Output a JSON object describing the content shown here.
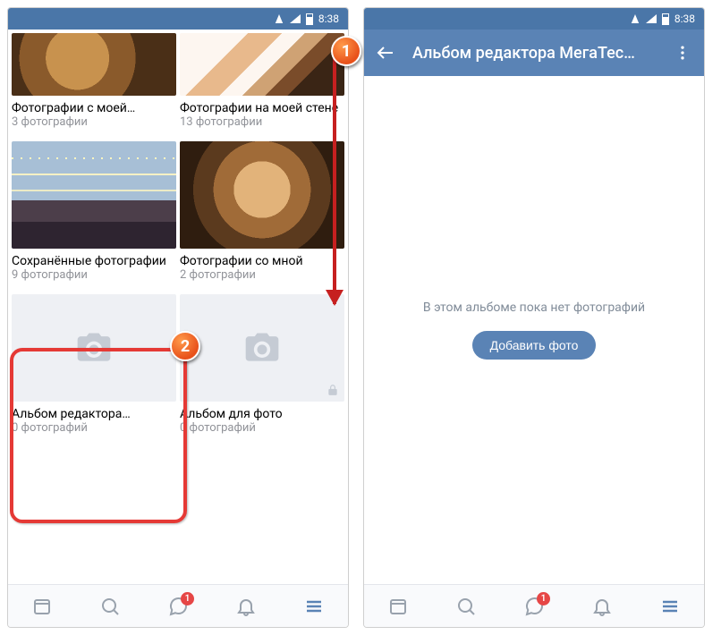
{
  "statusbar": {
    "time": "8:38"
  },
  "left": {
    "albums": [
      {
        "title": "Фотографии с моей…",
        "count": "3 фотографии"
      },
      {
        "title": "Фотографии на моей стене",
        "count": "13 фотографии"
      },
      {
        "title": "Сохранённые фотографии",
        "count": "9 фотографии"
      },
      {
        "title": "Фотографии со мной",
        "count": "2 фотографии"
      },
      {
        "title": "Альбом редактора…",
        "count": "0 фотографий"
      },
      {
        "title": "Альбом для фото",
        "count": "0 фотографий"
      }
    ]
  },
  "right": {
    "header_title": "Альбом редактора МегаТес…",
    "empty_msg": "В этом альбоме пока нет фотографий",
    "add_button": "Добавить фото"
  },
  "nav": {
    "messages_badge": "1"
  },
  "callouts": {
    "one": "1",
    "two": "2"
  }
}
